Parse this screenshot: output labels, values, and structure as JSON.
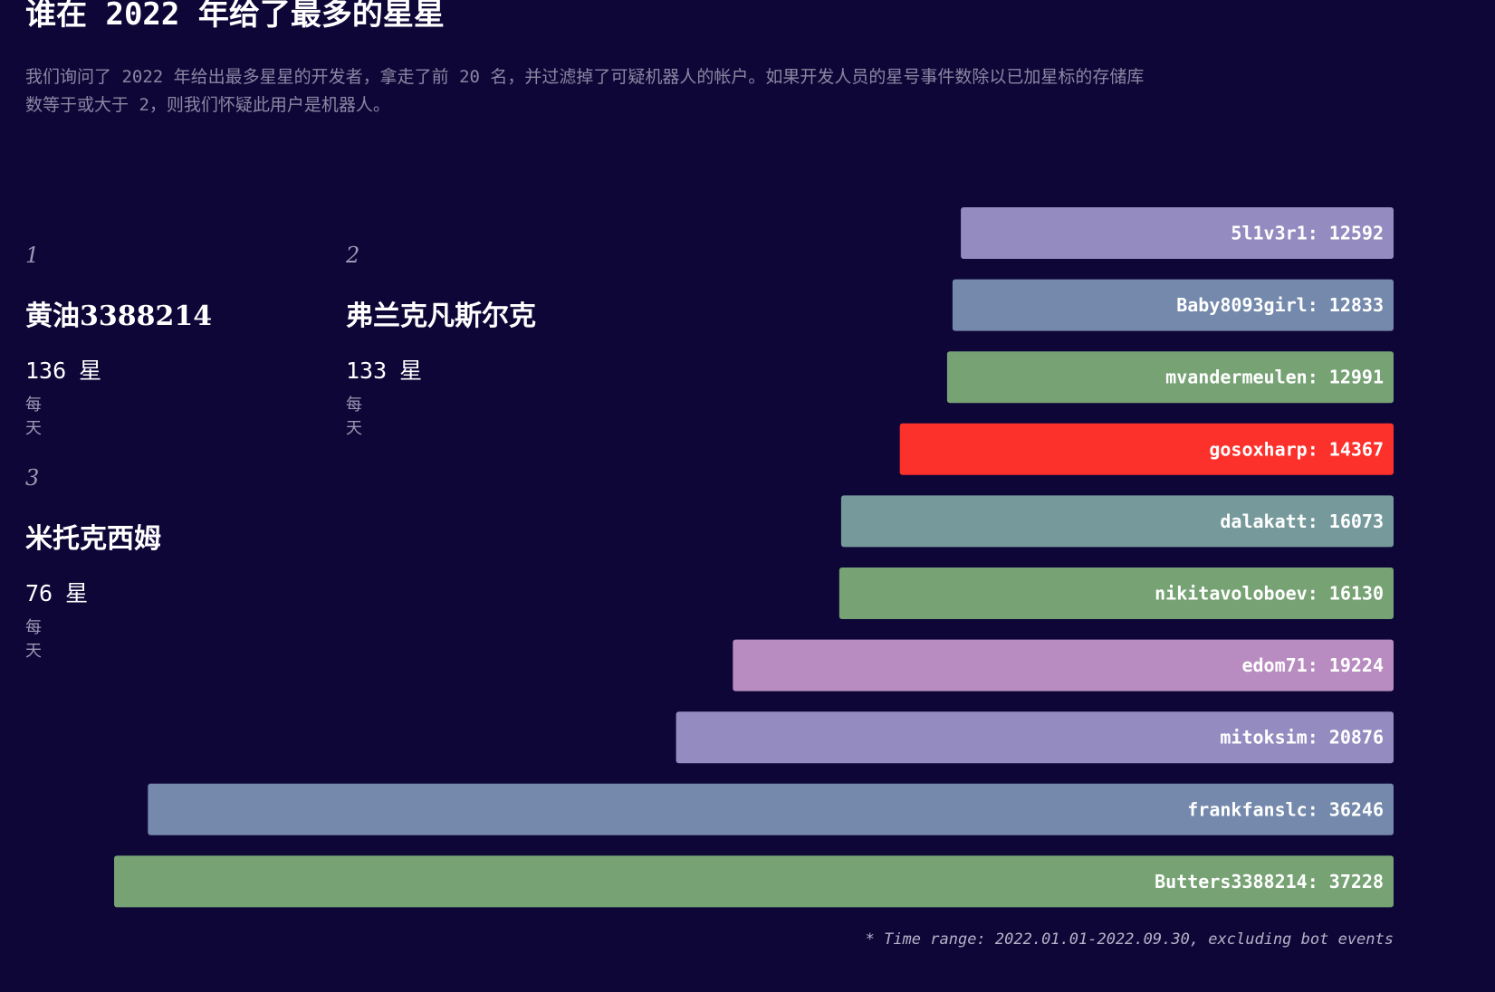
{
  "title": "谁在 2022 年给了最多的星星",
  "subtitle": "我们询问了 2022 年给出最多星星的开发者，拿走了前 20 名，并过滤掉了可疑机器人的帐户。如果开发人员的星号事件数除以已加星标的存储库数等于或大于 2，则我们怀疑此用户是机器人。",
  "ranking": [
    {
      "rank": "1",
      "name": "黄油3388214",
      "stars": "136",
      "unit": "星",
      "per": "每天"
    },
    {
      "rank": "2",
      "name": "弗兰克凡斯尔克",
      "stars": "133",
      "unit": "星",
      "per": "每天"
    },
    {
      "rank": "3",
      "name": "米托克西姆",
      "stars": "76",
      "unit": "星",
      "per": "每天"
    }
  ],
  "footnote": "* Time range: 2022.01.01-2022.09.30, excluding bot events",
  "chart_data": {
    "type": "bar",
    "orientation": "horizontal",
    "categories": [
      "5l1v3r1",
      "Baby8093girl",
      "mvandermeulen",
      "gosoxharp",
      "dalakatt",
      "nikitavoloboev",
      "edom71",
      "mitoksim",
      "frankfanslc",
      "Butters3388214"
    ],
    "values": [
      12592,
      12833,
      12991,
      14367,
      16073,
      16130,
      19224,
      20876,
      36246,
      37228
    ],
    "colors": [
      "#948cc0",
      "#7489ab",
      "#76a274",
      "#fc312c",
      "#769a9c",
      "#76a274",
      "#b88cc0",
      "#948cc0",
      "#7489ab",
      "#76a274"
    ],
    "label_format": "name: value",
    "xlabel": "",
    "ylabel": ""
  }
}
